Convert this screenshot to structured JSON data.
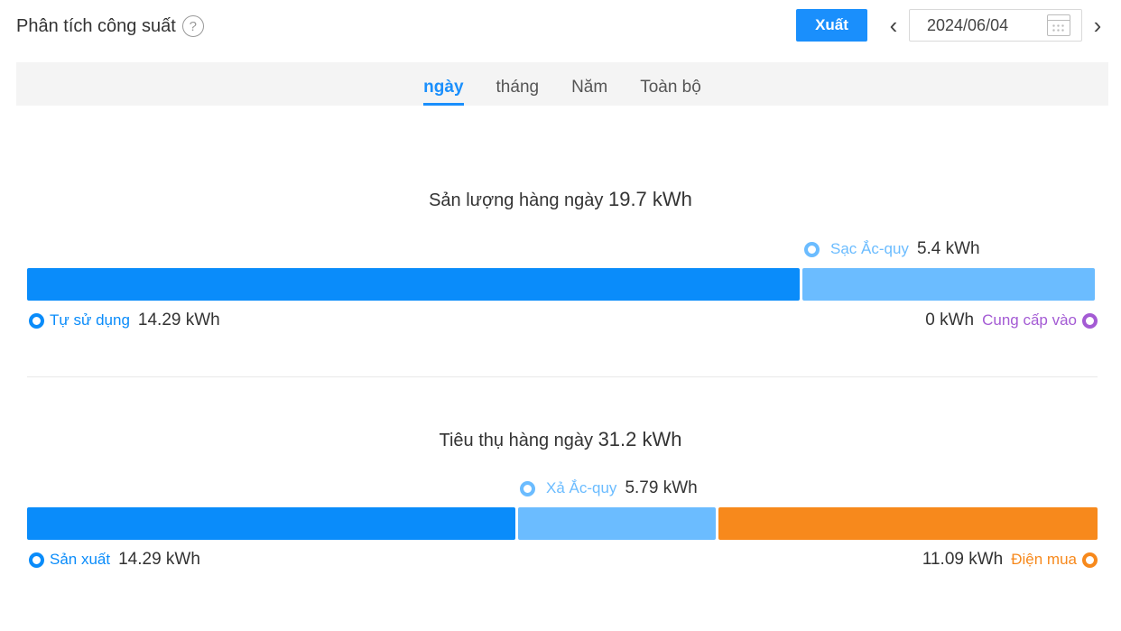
{
  "header": {
    "title": "Phân tích công suất",
    "help_icon": "question-circle-icon",
    "export_label": "Xuất",
    "date": "2024/06/04"
  },
  "tabs": [
    {
      "label": "ngày",
      "active": true
    },
    {
      "label": "tháng",
      "active": false
    },
    {
      "label": "Năm",
      "active": false
    },
    {
      "label": "Toàn bộ",
      "active": false
    }
  ],
  "colors": {
    "primary_blue": "#0a8cfa",
    "light_blue": "#6bbcff",
    "orange": "#f7891c",
    "purple": "#a45bd4"
  },
  "production": {
    "title": "Sản lượng hàng ngày",
    "total": "19.7 kWh",
    "self_use_label": "Tự sử dụng",
    "self_use_value": "14.29 kWh",
    "charge_label": "Sạc Ắc-quy",
    "charge_value": "5.4 kWh",
    "feed_in_label": "Cung cấp vào",
    "feed_in_value": "0 kWh",
    "segments": [
      14.29,
      5.4,
      0
    ]
  },
  "consumption": {
    "title": "Tiêu thụ hàng ngày",
    "total": "31.2 kWh",
    "produced_label": "Sản xuất",
    "produced_value": "14.29 kWh",
    "discharge_label": "Xả Ắc-quy",
    "discharge_value": "5.79 kWh",
    "purchased_label": "Điện mua",
    "purchased_value": "11.09 kWh",
    "segments": [
      14.29,
      5.79,
      11.09
    ]
  }
}
